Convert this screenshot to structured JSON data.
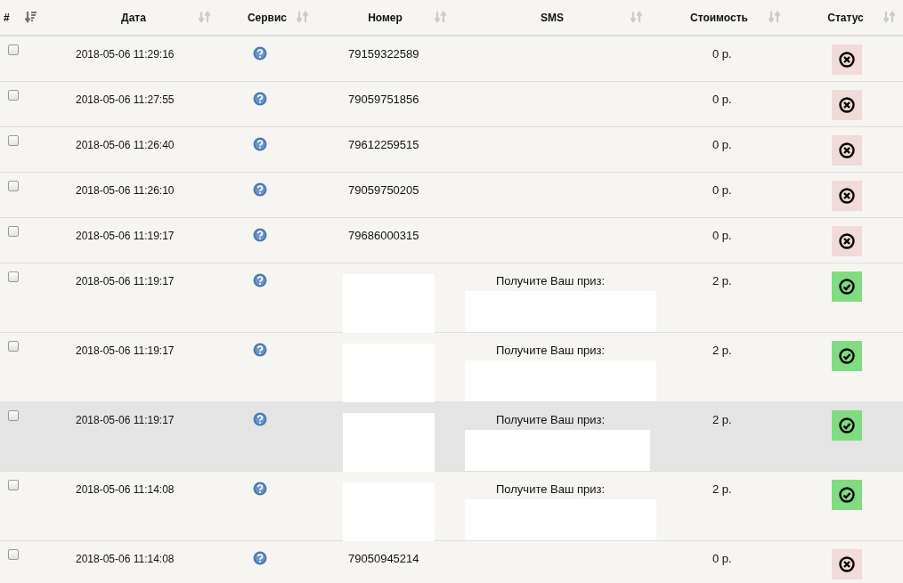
{
  "columns": [
    {
      "label": "#",
      "sorted": true
    },
    {
      "label": "Дата",
      "sorted": false
    },
    {
      "label": "Сервис",
      "sorted": false
    },
    {
      "label": "Номер",
      "sorted": false
    },
    {
      "label": "SMS",
      "sorted": false
    },
    {
      "label": "Стоимость",
      "sorted": false
    },
    {
      "label": "Статус",
      "sorted": false
    }
  ],
  "rows": [
    {
      "checked": false,
      "highlighted": false,
      "date": "2018-05-06 11:29:16",
      "number": "79159322589",
      "cost": "0 р.",
      "kind": "failed"
    },
    {
      "checked": false,
      "highlighted": false,
      "date": "2018-05-06 11:27:55",
      "number": "79059751856",
      "cost": "0 р.",
      "kind": "failed"
    },
    {
      "checked": false,
      "highlighted": false,
      "date": "2018-05-06 11:26:40",
      "number": "79612259515",
      "cost": "0 р.",
      "kind": "failed"
    },
    {
      "checked": false,
      "highlighted": false,
      "date": "2018-05-06 11:26:10",
      "number": "79059750205",
      "cost": "0 р.",
      "kind": "failed"
    },
    {
      "checked": false,
      "highlighted": false,
      "date": "2018-05-06 11:19:17",
      "number": "79686000315",
      "cost": "0 р.",
      "kind": "failed"
    },
    {
      "checked": false,
      "highlighted": false,
      "date": "2018-05-06 11:19:17",
      "number_redacted": true,
      "sms": "Получите Ваш приз:",
      "cost": "2 р.",
      "kind": "delivered"
    },
    {
      "checked": false,
      "highlighted": false,
      "date": "2018-05-06 11:19:17",
      "number_redacted": true,
      "sms": "Получите Ваш приз:",
      "cost": "2 р.",
      "kind": "delivered"
    },
    {
      "checked": false,
      "highlighted": true,
      "date": "2018-05-06 11:19:17",
      "number_redacted": true,
      "sms": "Получите Ваш приз:",
      "cost": "2 р.",
      "kind": "delivered"
    },
    {
      "checked": false,
      "highlighted": false,
      "date": "2018-05-06 11:14:08",
      "number_redacted": true,
      "sms": "Получите Ваш приз:",
      "cost": "2 р.",
      "kind": "delivered"
    },
    {
      "checked": false,
      "highlighted": false,
      "date": "2018-05-06 11:14:08",
      "number": "79050945214",
      "cost": "0 р.",
      "kind": "failed"
    }
  ]
}
